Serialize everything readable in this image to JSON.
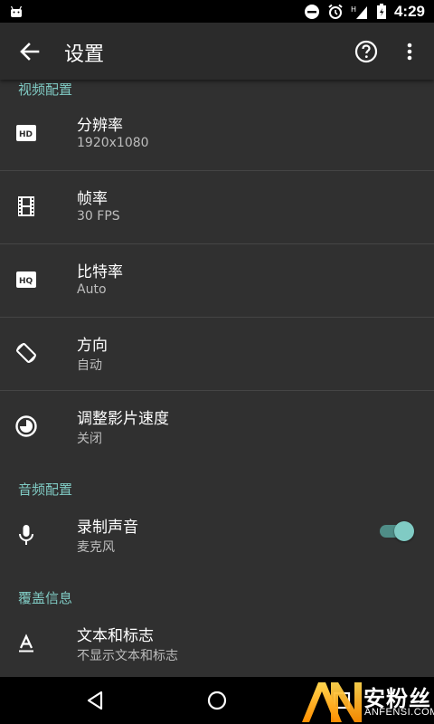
{
  "status_bar": {
    "time": "4:29",
    "icons": [
      "android-icon",
      "dnd-icon",
      "alarm-icon",
      "signal-icon",
      "battery-icon"
    ]
  },
  "app_bar": {
    "title": "设置",
    "icons": [
      "back-arrow-icon",
      "help-icon",
      "more-vert-icon"
    ]
  },
  "sections": {
    "video": {
      "header": "视频配置",
      "items": [
        {
          "title": "分辨率",
          "summary": "1920x1080",
          "icon": "hd-icon"
        },
        {
          "title": "帧率",
          "summary": "30 FPS",
          "icon": "film-icon"
        },
        {
          "title": "比特率",
          "summary": "Auto",
          "icon": "hq-icon"
        },
        {
          "title": "方向",
          "summary": "自动",
          "icon": "screen-rotation-icon"
        },
        {
          "title": "调整影片速度",
          "summary": "关闭",
          "icon": "speed-icon"
        }
      ]
    },
    "audio": {
      "header": "音频配置",
      "items": [
        {
          "title": "录制声音",
          "summary": "麦克风",
          "icon": "mic-icon",
          "toggle_on": true
        }
      ]
    },
    "overlay": {
      "header": "覆盖信息",
      "items": [
        {
          "title": "文本和标志",
          "summary": "不显示文本和标志",
          "icon": "text-format-icon"
        }
      ]
    }
  },
  "nav_bar": {
    "icons": [
      "back-triangle-icon",
      "home-circle-icon",
      "recents-square-icon"
    ]
  },
  "watermark": {
    "logo": "AN",
    "cn": "安粉丝",
    "en": "ANFENSI.COM"
  },
  "colors": {
    "accent": "#80cbc4",
    "background": "#303030",
    "app_bar": "#2b2b2b",
    "divider": "#454545",
    "summary_text": "#bdbdbd"
  }
}
